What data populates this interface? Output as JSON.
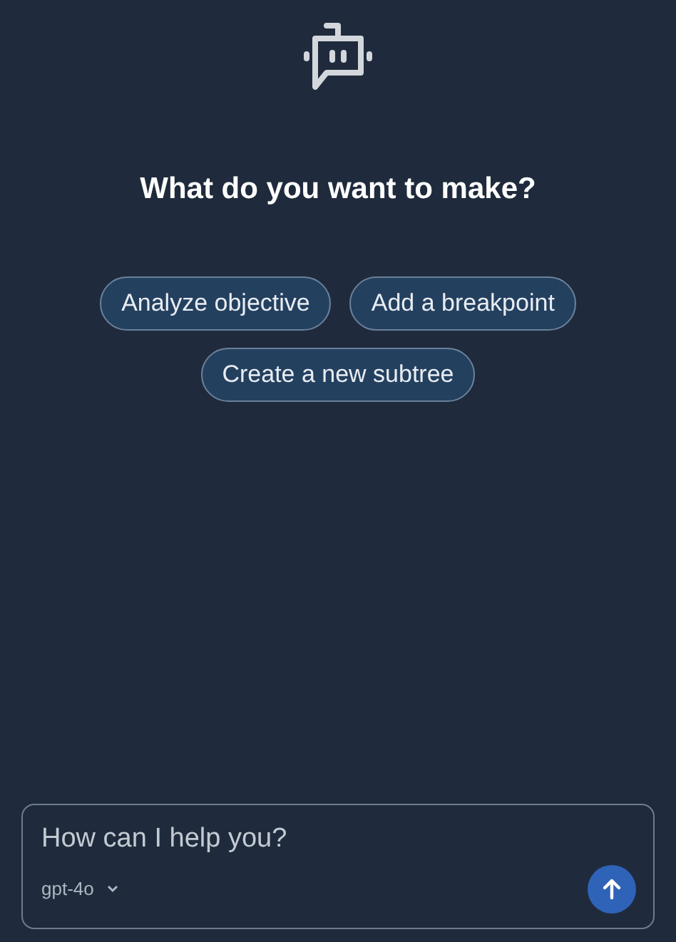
{
  "heading": "What do you want to make?",
  "suggestions": [
    "Analyze objective",
    "Add a breakpoint",
    "Create a new subtree"
  ],
  "composer": {
    "placeholder": "How can I help you?",
    "model": "gpt-4o"
  }
}
